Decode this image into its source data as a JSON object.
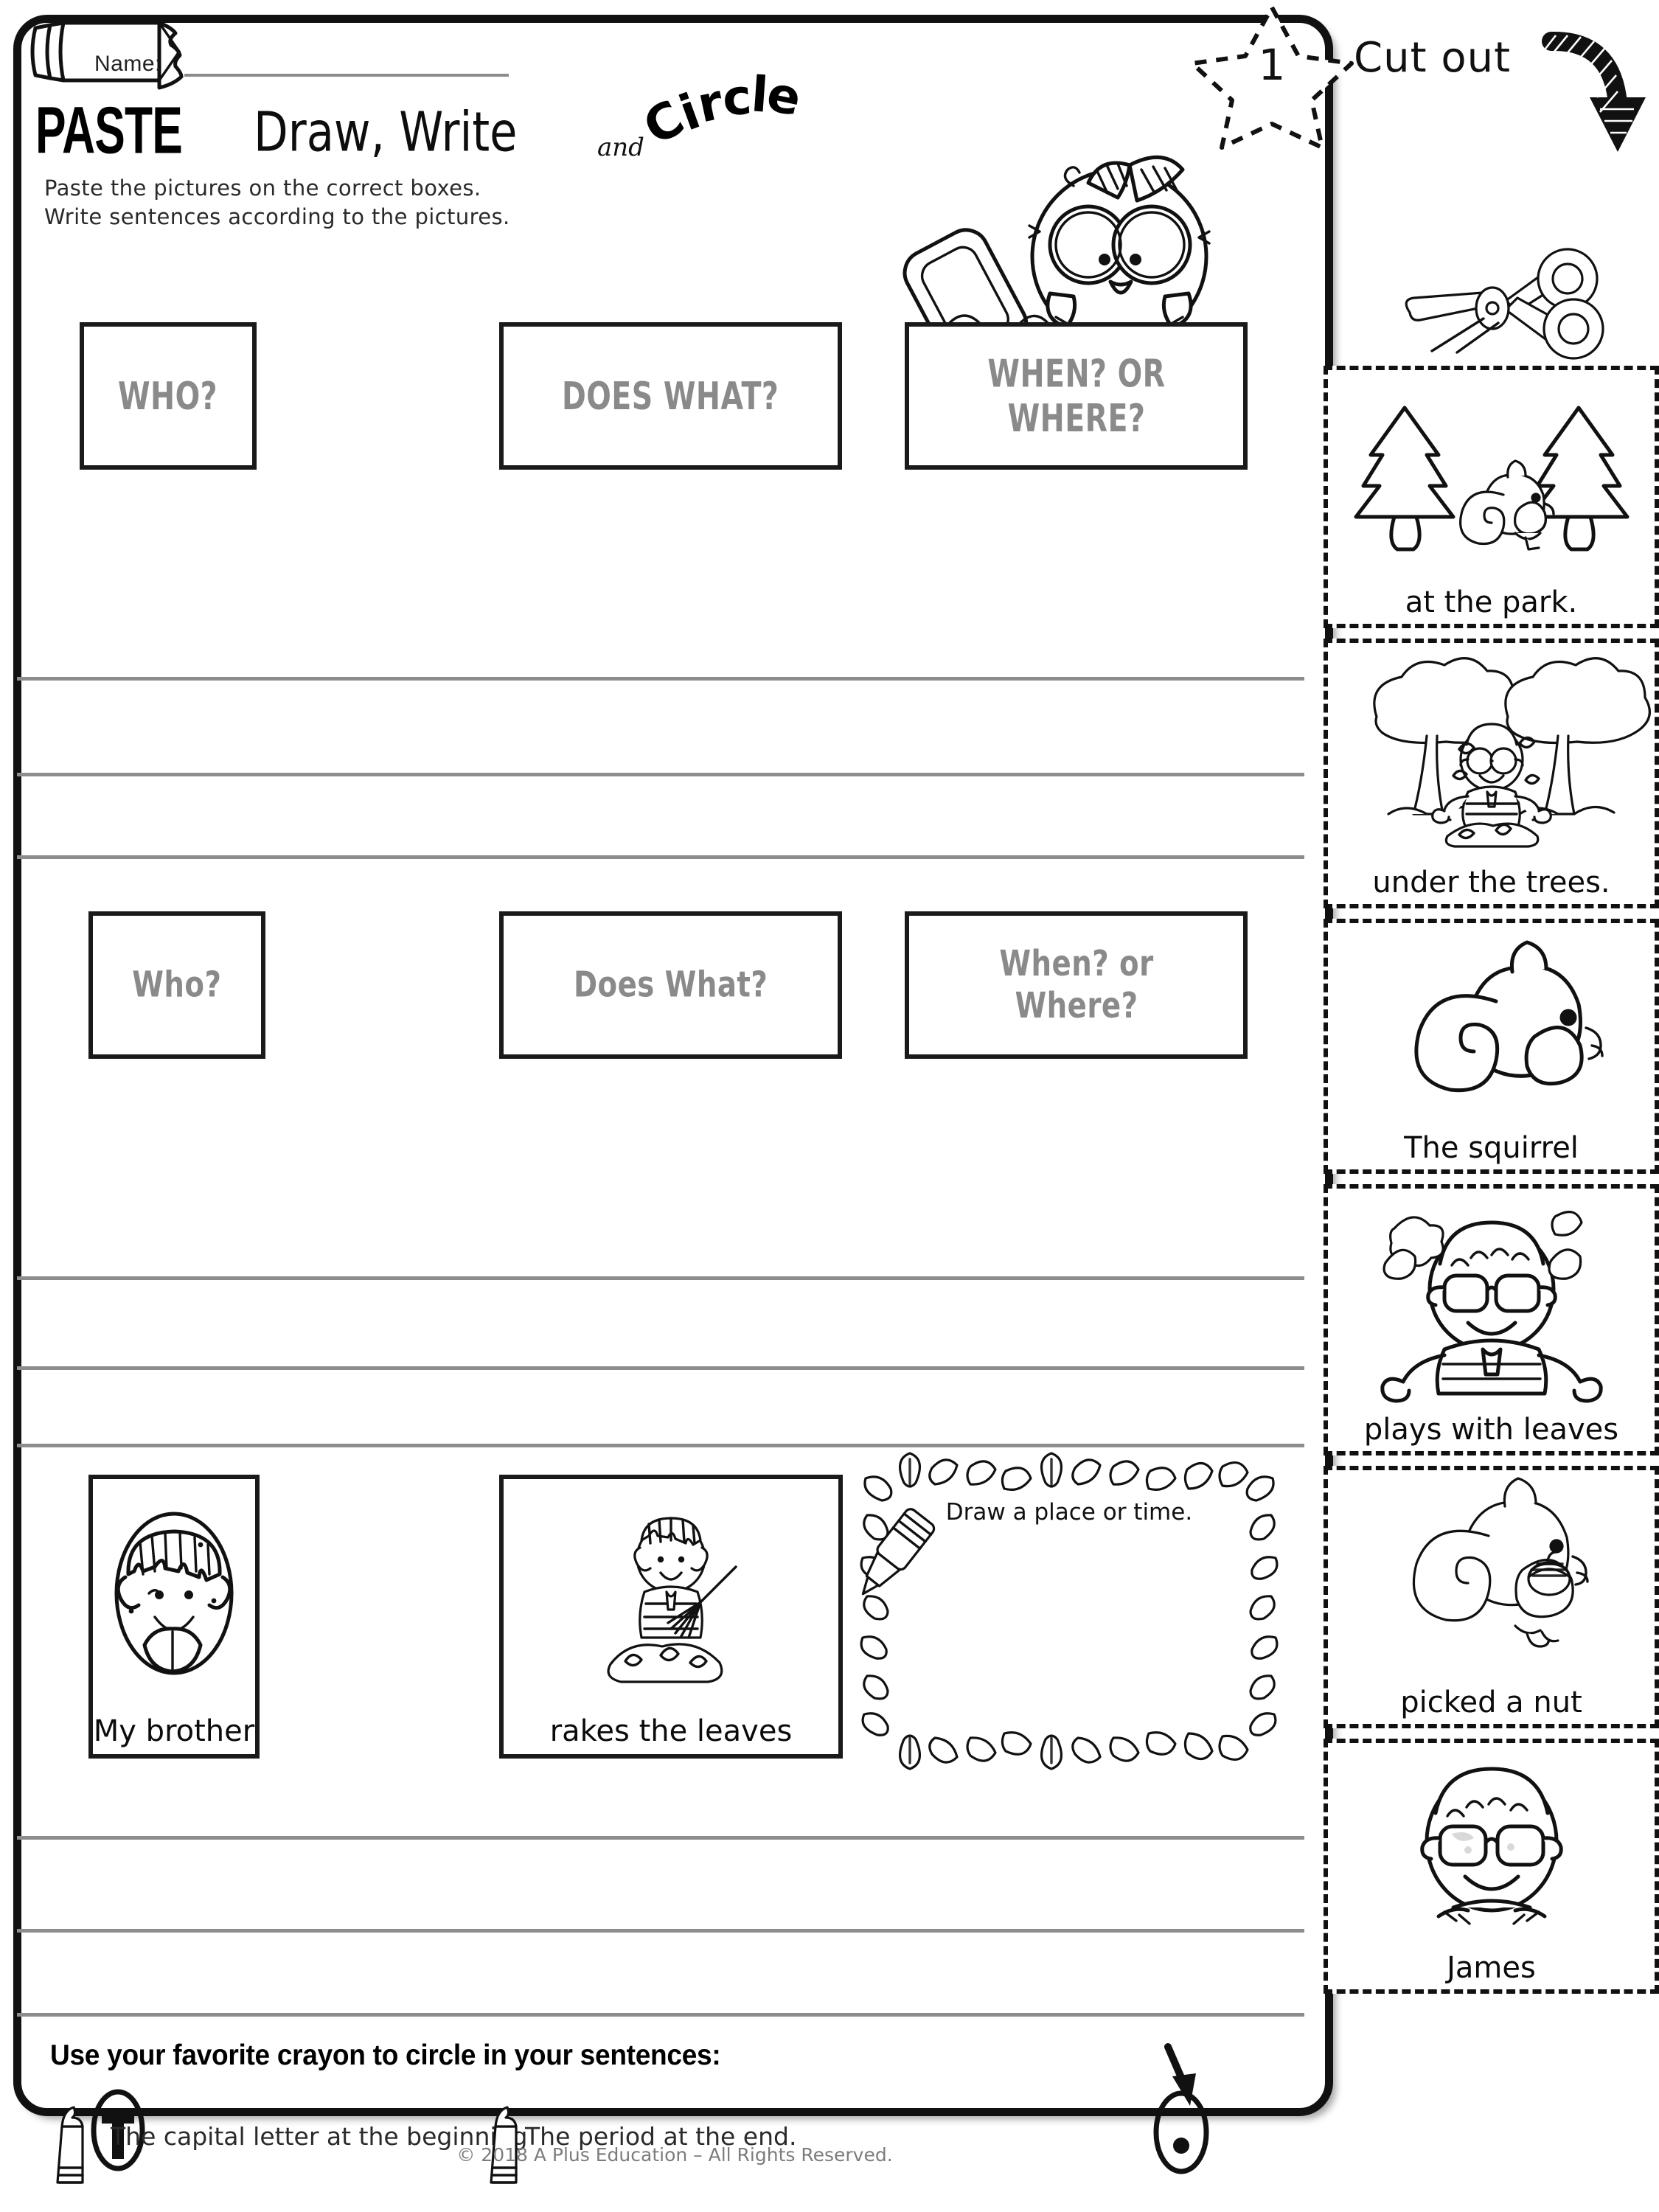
{
  "page": {
    "name_label": "Name:",
    "star_number": "1",
    "cut_out_label": "Cut out",
    "footer": "© 2018 A Plus Education – All Rights Reserved."
  },
  "title": {
    "word1": "PASTE",
    "word1_comma": ",",
    "word2": "Draw, Write",
    "conjunction": "and",
    "word3": "Circle"
  },
  "instructions": {
    "line1": "Paste the pictures on the correct boxes.",
    "line2": "Write sentences according to the pictures."
  },
  "rows": {
    "row1_caps": [
      {
        "label": "WHO?",
        "icon": "empty-paste-box"
      },
      {
        "label": "DOES WHAT?",
        "icon": "empty-paste-box"
      },
      {
        "label": "WHEN? OR WHERE?",
        "icon": "empty-paste-box"
      }
    ],
    "row2_lower": [
      {
        "label": "Who?",
        "icon": "empty-paste-box"
      },
      {
        "label": "Does What?",
        "icon": "empty-paste-box"
      },
      {
        "label": "When? or Where?",
        "icon": "empty-paste-box"
      }
    ],
    "row3_example": [
      {
        "label": "My brother",
        "icon": "boy-face-icon"
      },
      {
        "label": "rakes the leaves",
        "icon": "boy-raking-leaves-icon"
      }
    ],
    "draw_box": {
      "label": "Draw a place or time.",
      "icon": "leaf-border-frame"
    }
  },
  "bottom": {
    "heading": "Use your favorite crayon to circle in your sentences:",
    "item1": "The capital letter at the beginning",
    "item2": "The period at the end.",
    "item1_mark": "T",
    "item2_mark": "."
  },
  "cut_cards": [
    {
      "label": "at the park.",
      "icon": "trees-with-squirrel-icon"
    },
    {
      "label": "under the trees.",
      "icon": "boy-under-trees-icon"
    },
    {
      "label": "The squirrel",
      "icon": "squirrel-icon"
    },
    {
      "label": "plays with leaves",
      "icon": "boy-with-leaves-icon"
    },
    {
      "label": "picked a nut",
      "icon": "squirrel-with-nut-icon"
    },
    {
      "label": "James",
      "icon": "boy-face-glasses-icon"
    }
  ],
  "colors": {
    "ink": "#111111",
    "label_gray": "#8a8a8a",
    "line_gray": "#8d8d8d",
    "footer_gray": "#7c7c7c"
  }
}
